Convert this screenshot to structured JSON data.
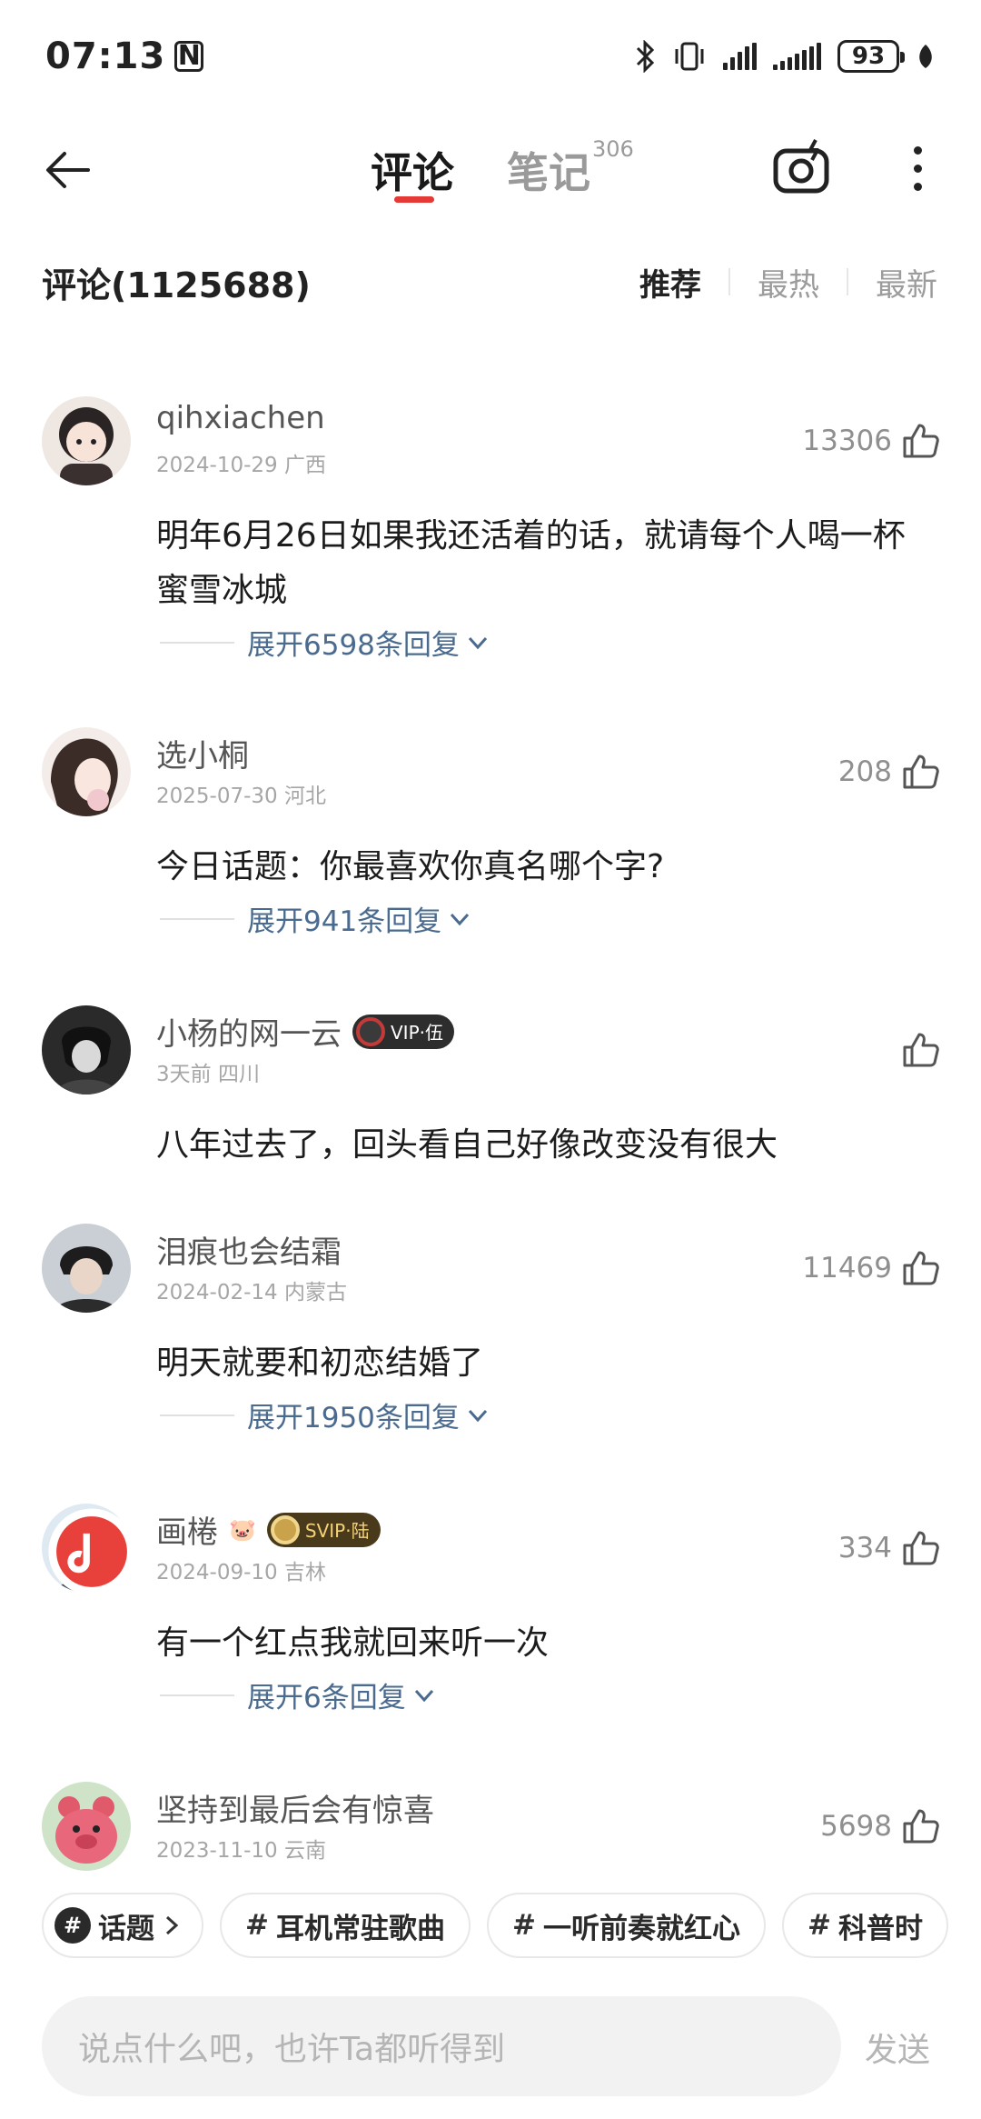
{
  "status_bar": {
    "time": "07:13",
    "nfc": "N",
    "battery": "93"
  },
  "nav": {
    "tab_comments": "评论",
    "tab_notes": "笔记",
    "tab_notes_count": "306"
  },
  "comments_header": {
    "title": "评论(1125688)",
    "sort": [
      "推荐",
      "最热",
      "最新"
    ],
    "active_sort": "推荐"
  },
  "comments": [
    {
      "username": "qihxiachen",
      "meta": "2024-10-29 广西",
      "likes": "13306",
      "text": "明年6月26日如果我还活着的话，就请每个人喝一杯蜜雪冰城",
      "replies": "展开6598条回复"
    },
    {
      "username": "选小桐",
      "meta": "2025-07-30 河北",
      "likes": "208",
      "text": "今日话题：你最喜欢你真名哪个字?",
      "replies": "展开941条回复"
    },
    {
      "username": "小杨的网一云",
      "badge": "VIP·伍",
      "meta": "3天前 四川",
      "likes": "",
      "text": "八年过去了，回头看自己好像改变没有很大"
    },
    {
      "username": "泪痕也会结霜",
      "meta": "2024-02-14 内蒙古",
      "likes": "11469",
      "text": "明天就要和初恋结婚了",
      "replies": "展开1950条回复"
    },
    {
      "username": "画棬",
      "badge": "SVIP·陆",
      "meta": "2024-09-10 吉林",
      "likes": "334",
      "text": "有一个红点我就回来听一次",
      "replies": "展开6条回复"
    },
    {
      "username": "坚持到最后会有惊喜",
      "meta": "2023-11-10 云南",
      "likes": "5698"
    }
  ],
  "chips": {
    "topic": "话题",
    "tags": [
      "耳机常驻歌曲",
      "一听前奏就红心",
      "科普时"
    ]
  },
  "input": {
    "placeholder": "说点什么吧，也许Ta都听得到",
    "send": "发送"
  },
  "colors": {
    "accent": "#e53935",
    "reply_link": "#4a6b8f"
  }
}
